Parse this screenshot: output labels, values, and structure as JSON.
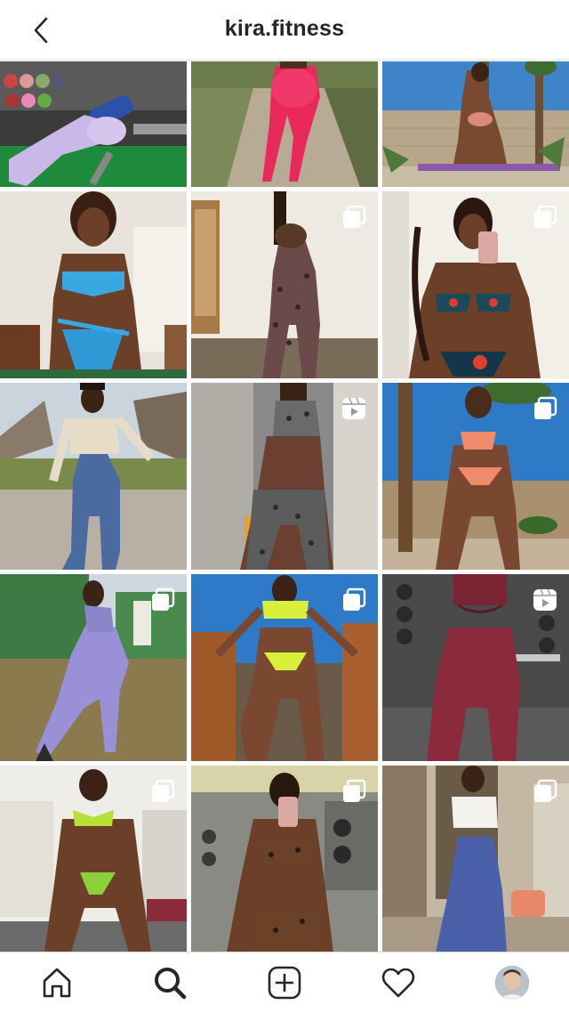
{
  "header": {
    "title": "kira.fitness",
    "back_icon": "chevron-left-icon"
  },
  "grid": {
    "posts": [
      {
        "badge": "none",
        "scene": "gym-bench-lavender-leggings"
      },
      {
        "badge": "none",
        "scene": "dirt-path-pink-leggings"
      },
      {
        "badge": "none",
        "scene": "desert-wall-palm-trees"
      },
      {
        "badge": "none",
        "scene": "indoor-blue-bikini-smile"
      },
      {
        "badge": "carousel-icon",
        "scene": "indoor-leopard-set"
      },
      {
        "badge": "carousel-icon",
        "scene": "mirror-selfie-floral-bikini"
      },
      {
        "badge": "none",
        "scene": "park-jeans-crop-top"
      },
      {
        "badge": "reel-icon",
        "scene": "gym-leopard-set"
      },
      {
        "badge": "carousel-icon",
        "scene": "palm-peach-bikini"
      },
      {
        "badge": "carousel-icon",
        "scene": "yard-lavender-leggings"
      },
      {
        "badge": "carousel-icon",
        "scene": "deck-neon-bikini"
      },
      {
        "badge": "reel-icon",
        "scene": "gym-maroon-leggings"
      },
      {
        "badge": "carousel-icon",
        "scene": "living-room-green-bikini"
      },
      {
        "badge": "carousel-icon",
        "scene": "gym-mirror-leopard"
      },
      {
        "badge": "carousel-icon",
        "scene": "garage-white-top-bluepants"
      }
    ]
  },
  "tabbar": {
    "items": [
      "home-icon",
      "search-icon",
      "new-post-icon",
      "activity-heart-icon",
      "profile-avatar"
    ]
  },
  "colors": {
    "text": "#262626",
    "border": "#dbdbdb",
    "background": "#ffffff"
  }
}
